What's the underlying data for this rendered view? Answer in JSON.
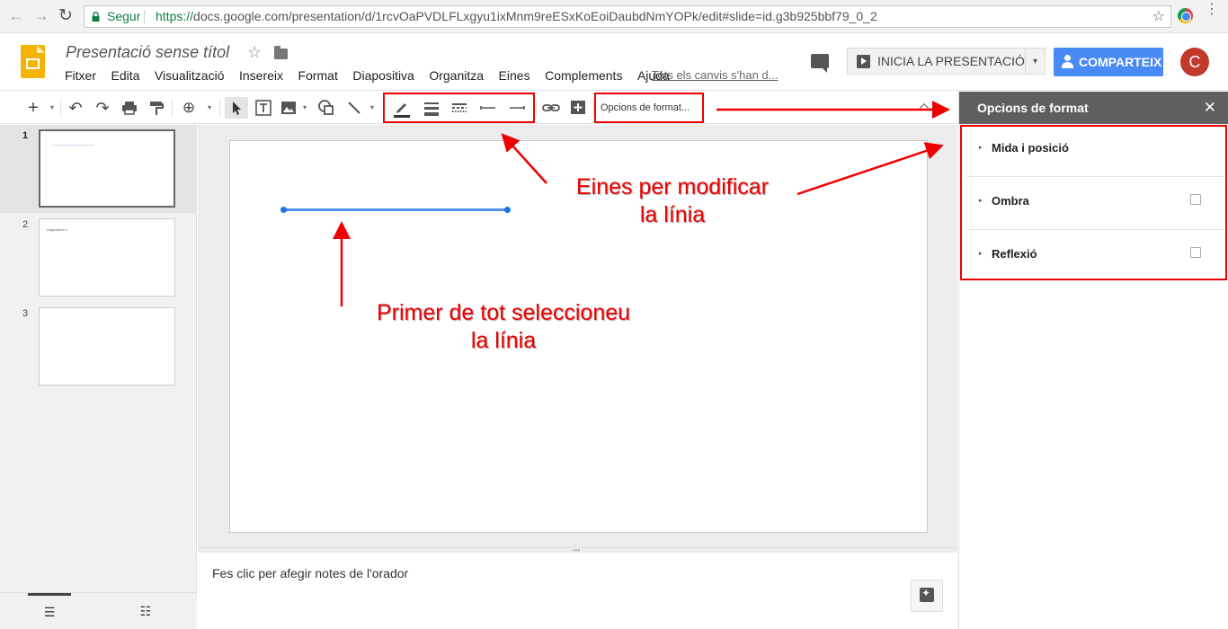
{
  "browser": {
    "secure_label": "Segur",
    "url_scheme": "https://",
    "url_rest": "docs.google.com/presentation/d/1rcvOaPVDLFLxgyu1ixMnm9reESxKoEoiDaubdNmYOPk/edit#slide=id.g3b925bbf79_0_2",
    "back_icon": "←",
    "forward_icon": "→",
    "reload_icon": "↻",
    "bookmark_icon": "☆",
    "menu_icon": "⋮"
  },
  "app": {
    "doc_title": "Presentació sense títol",
    "star_icon": "☆",
    "menus": [
      "Fitxer",
      "Edita",
      "Visualització",
      "Insereix",
      "Format",
      "Diapositiva",
      "Organitza",
      "Eines",
      "Complements",
      "Ajuda"
    ],
    "saved_status": "Tots els canvis s'han d...",
    "present_label": "INICIA LA PRESENTACIÓ",
    "present_caret": "▾",
    "share_label": "COMPARTEIX",
    "avatar_letter": "C",
    "brand_color": "#f4b400",
    "share_color": "#4a8af4"
  },
  "toolbar": {
    "new_icon": "+",
    "caret": "▾",
    "undo_icon": "↶",
    "redo_icon": "↷",
    "zoom_icon": "⊕",
    "format_options": "Opcions de format..."
  },
  "filmstrip": {
    "slides": [
      {
        "num": "1",
        "text": ""
      },
      {
        "num": "2",
        "text": "Diapositiva 2"
      },
      {
        "num": "3",
        "text": ""
      }
    ],
    "list_icon": "☰",
    "grid_icon": "☷"
  },
  "notes": {
    "placeholder": "Fes clic per afegir notes de l'orador",
    "grip": "•••"
  },
  "panel": {
    "title": "Opcions de format",
    "close_icon": "✕",
    "tri_icon": "▸",
    "sections": [
      {
        "label": "Mida i posició",
        "has_checkbox": false
      },
      {
        "label": "Ombra",
        "has_checkbox": true,
        "checked": false
      },
      {
        "label": "Reflexió",
        "has_checkbox": true,
        "checked": false
      }
    ]
  },
  "annotations": {
    "tools_line1": "Eines per modificar",
    "tools_line2": "la línia",
    "select_line1": "Primer de tot seleccioneu",
    "select_line2": "la línia",
    "color": "#e00000"
  }
}
